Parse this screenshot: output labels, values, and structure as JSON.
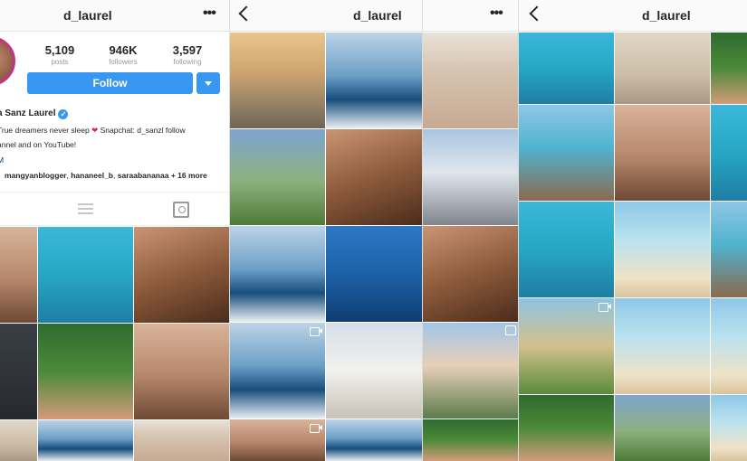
{
  "colors": {
    "accent": "#3897f0",
    "story_ring": "#c13584",
    "heart": "#e0245e",
    "verified": "#3897f0"
  },
  "panels": {
    "profile": {
      "username": "d_laurel",
      "menu_icon": "more-icon",
      "stats": [
        {
          "value": "5,109",
          "label": "posts"
        },
        {
          "value": "946K",
          "label": "followers"
        },
        {
          "value": "3,597",
          "label": "following"
        }
      ],
      "follow_label": "Follow",
      "full_name": "a Sanz Laurel",
      "bio_line1_pre": "True dreamers never sleep",
      "bio_line1_post": "Snapchat: d_sanzl follow",
      "bio_line2": "annel and on YouTube!",
      "bio_more": "M",
      "tagged_users": [
        "mangyanblogger",
        "hananeel_b",
        "saraabananaa"
      ],
      "tagged_more": "+ 16 more",
      "tabs": [
        "list-icon",
        "tagged-icon"
      ]
    },
    "feed_a": {
      "username": "d_laurel",
      "back_icon": "back-icon"
    },
    "feed_b": {
      "menu_icon": "more-icon"
    },
    "feed_c": {
      "username": "d_laurel",
      "back_icon": "back-icon"
    }
  }
}
